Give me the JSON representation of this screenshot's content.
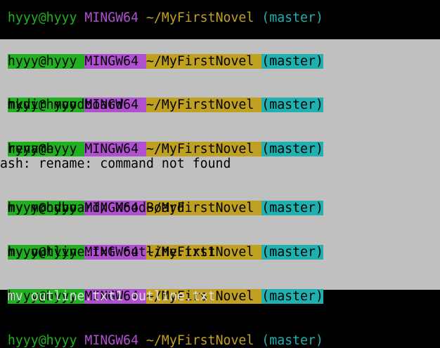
{
  "terminal": {
    "prompt": {
      "user_host": "hyyy@hyyy",
      "system": "MINGW64",
      "path": "~/MyFirstNovel",
      "branch": "(master)"
    },
    "lines": [
      {
        "type": "prompt"
      },
      {
        "type": "prompt"
      },
      {
        "type": "prompt"
      },
      {
        "type": "command",
        "text": "$ mkdir moodboard"
      },
      {
        "type": "prompt"
      },
      {
        "type": "command",
        "text": "$ rename"
      },
      {
        "type": "output",
        "text": "bash: rename: command not found"
      },
      {
        "type": "prompt"
      },
      {
        "type": "command",
        "text": "$ mv moodboard/ MoodBoard"
      },
      {
        "type": "prompt"
      },
      {
        "type": "command",
        "text": "$ mv outline.txt outline.txt1"
      },
      {
        "type": "prompt"
      },
      {
        "type": "command",
        "text": "$ mv outline.txt1 outline.txt"
      },
      {
        "type": "prompt"
      }
    ]
  },
  "colors": {
    "background": "#000000",
    "selection": "#c0c0c0",
    "user_green": "#20b020",
    "mingw_purple": "#b050d0",
    "path_gold": "#c0a020",
    "branch_cyan": "#20b0b0"
  }
}
